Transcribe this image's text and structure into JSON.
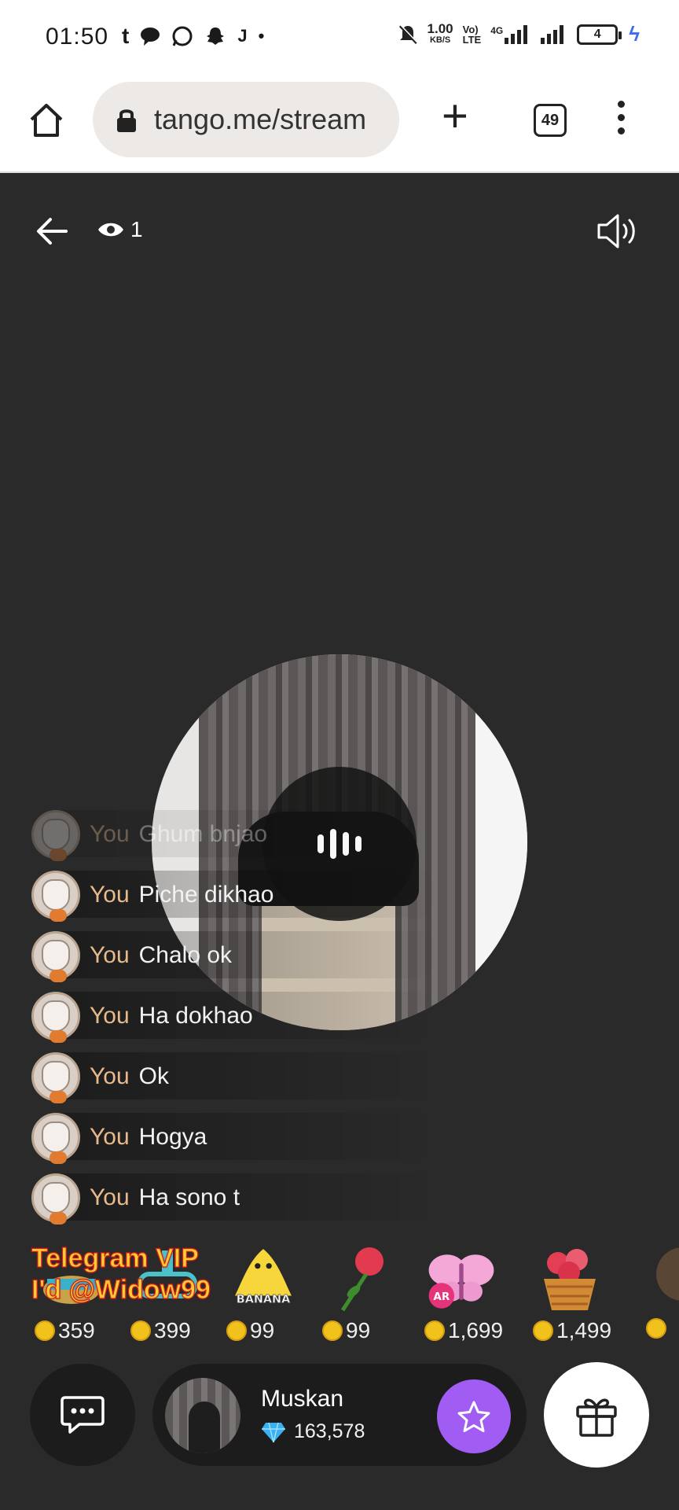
{
  "status_bar": {
    "time": "01:50",
    "left_icons": [
      "tumblr-icon",
      "chat-bubble-icon",
      "whatsapp-icon",
      "snapchat-icon",
      "j-app-icon",
      "dot-icon"
    ],
    "net_speed_value": "1.00",
    "net_speed_unit": "KB/S",
    "volte_top": "Vo)",
    "volte_bottom": "LTE",
    "network_label": "4G",
    "battery_level": "4"
  },
  "browser": {
    "url": "tango.me/stream",
    "tab_count": "49",
    "icons": [
      "home-icon",
      "lock-icon",
      "plus-icon",
      "tabs-icon",
      "more-vert-icon"
    ]
  },
  "stream": {
    "viewer_count": "1",
    "icons": [
      "back-arrow-icon",
      "eye-icon",
      "speaker-icon",
      "audio-waveform-icon"
    ]
  },
  "chat": {
    "messages": [
      {
        "name": "You",
        "text": "Ghum bnjao"
      },
      {
        "name": "You",
        "text": "Piche dikhao"
      },
      {
        "name": "You",
        "text": "Chalo ok"
      },
      {
        "name": "You",
        "text": "Ha dokhao"
      },
      {
        "name": "You",
        "text": "Ok"
      },
      {
        "name": "You",
        "text": "Hogya"
      },
      {
        "name": "You",
        "text": "Ha sono t"
      }
    ]
  },
  "gifts": [
    {
      "icon": "gift-lamp-icon",
      "price": "359"
    },
    {
      "icon": "gift-goggles-icon",
      "price": "399"
    },
    {
      "icon": "banana-icon",
      "price": "99",
      "badge": "BANANA"
    },
    {
      "icon": "rose-icon",
      "price": "99"
    },
    {
      "icon": "butterfly-icon",
      "price": "1,699",
      "badge": "AR"
    },
    {
      "icon": "flower-basket-icon",
      "price": "1,499"
    },
    {
      "icon": "gift-partial-icon",
      "price": ""
    }
  ],
  "watermark": {
    "line1": "Telegram VIP",
    "line2": "I'd @Widow99"
  },
  "bottom_bar": {
    "streamer_name": "Muskan",
    "diamond_count": "163,578",
    "icons": [
      "chat-icon",
      "diamond-icon",
      "star-icon",
      "gift-icon"
    ]
  },
  "colors": {
    "background": "#2a2a2b",
    "follow_button": "#a05cf3",
    "chat_name": "#e7b98c",
    "coin": "#f1c21b",
    "diamond": "#3ab0f0"
  }
}
